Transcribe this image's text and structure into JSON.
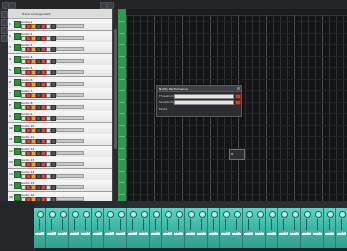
{
  "track_list": {
    "header_title": "Track Arrangement",
    "tracks": [
      {
        "num": "1",
        "name": "Audio 1"
      },
      {
        "num": "2",
        "name": "Audio 2"
      },
      {
        "num": "3",
        "name": "Audio 3"
      },
      {
        "num": "4",
        "name": "Audio 4"
      },
      {
        "num": "5",
        "name": "Audio 5"
      },
      {
        "num": "6",
        "name": "Audio 6"
      },
      {
        "num": "7",
        "name": "Audio 7"
      },
      {
        "num": "8",
        "name": "Audio 8"
      },
      {
        "num": "9",
        "name": "Audio 9"
      },
      {
        "num": "10",
        "name": "Audio 10"
      },
      {
        "num": "11",
        "name": "Audio 11"
      },
      {
        "num": "12",
        "name": "Audio 12"
      },
      {
        "num": "13",
        "name": "Audio 13"
      },
      {
        "num": "14",
        "name": "Audio 14"
      },
      {
        "num": "15",
        "name": "Audio 15"
      },
      {
        "num": "16",
        "name": "Audio 16"
      }
    ]
  },
  "notify_panel": {
    "title": "Notify Performance",
    "row1_label": "Threshold",
    "row2_label": "Sensitivity",
    "row3_label": "Mode"
  },
  "cursor_box": {
    "text": "B:"
  },
  "mixer": {
    "strips": [
      "Audio 1",
      "Audio 2",
      "Audio 3",
      "Audio 4",
      "Audio 5",
      "Audio 6",
      "Audio 7",
      "Audio 8",
      "Audio 9",
      "Audio 10",
      "Audio 11",
      "Audio 12",
      "Audio 13",
      "Audio 14",
      "Audio 15",
      "Audio 16",
      "Audio 17",
      "Audio 18",
      "Audio 19",
      "Audio 20",
      "Audio 21",
      "Audio 22",
      "Audio 23",
      "Audio 24",
      "Audio 25",
      "Audio 26",
      "Audio 27"
    ]
  },
  "colors": {
    "track_enable": "#2f8f3a",
    "ruler_green": "#2e9b4c",
    "mixer_teal": "#3fb8a5",
    "panel_red": "#c9452f"
  }
}
